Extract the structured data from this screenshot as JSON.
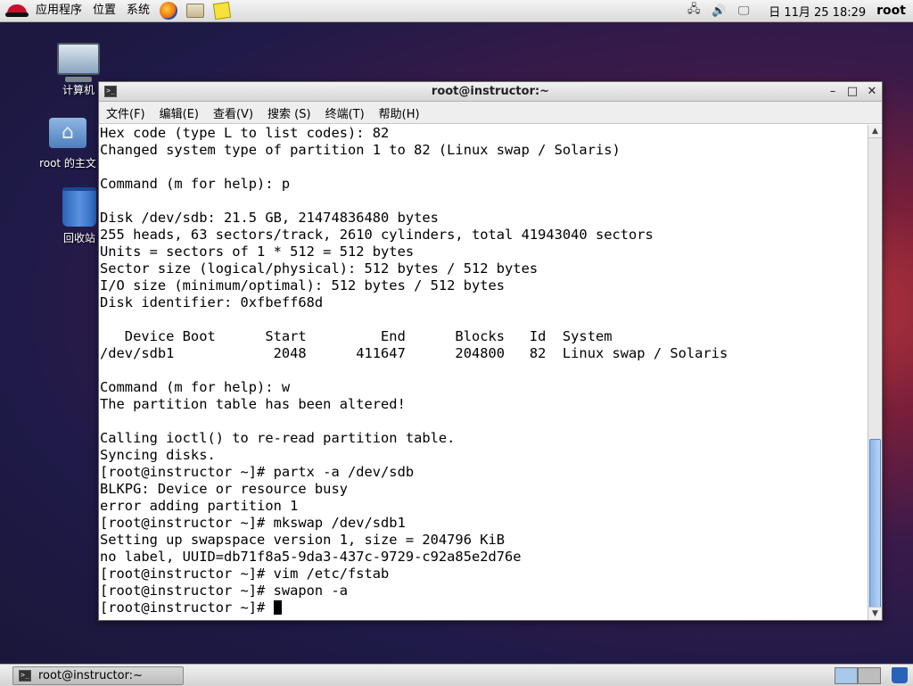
{
  "top_panel": {
    "menus": [
      "应用程序",
      "位置",
      "系统"
    ],
    "clock": "日 11月 25 18:29",
    "user": "root"
  },
  "desktop": {
    "icons": [
      "计算机",
      "root 的主文",
      "回收站"
    ]
  },
  "window": {
    "title": "root@instructor:~",
    "menus": [
      "文件(F)",
      "编辑(E)",
      "查看(V)",
      "搜索 (S)",
      "终端(T)",
      "帮助(H)"
    ],
    "lines": [
      "Hex code (type L to list codes): 82",
      "Changed system type of partition 1 to 82 (Linux swap / Solaris)",
      "",
      "Command (m for help): p",
      "",
      "Disk /dev/sdb: 21.5 GB, 21474836480 bytes",
      "255 heads, 63 sectors/track, 2610 cylinders, total 41943040 sectors",
      "Units = sectors of 1 * 512 = 512 bytes",
      "Sector size (logical/physical): 512 bytes / 512 bytes",
      "I/O size (minimum/optimal): 512 bytes / 512 bytes",
      "Disk identifier: 0xfbeff68d",
      "",
      "   Device Boot      Start         End      Blocks   Id  System",
      "/dev/sdb1            2048      411647      204800   82  Linux swap / Solaris",
      "",
      "Command (m for help): w",
      "The partition table has been altered!",
      "",
      "Calling ioctl() to re-read partition table.",
      "Syncing disks.",
      "[root@instructor ~]# partx -a /dev/sdb",
      "BLKPG: Device or resource busy",
      "error adding partition 1",
      "[root@instructor ~]# mkswap /dev/sdb1",
      "Setting up swapspace version 1, size = 204796 KiB",
      "no label, UUID=db71f8a5-9da3-437c-9729-c92a85e2d76e",
      "[root@instructor ~]# vim /etc/fstab",
      "[root@instructor ~]# swapon -a"
    ],
    "prompt": "[root@instructor ~]# "
  },
  "taskbar": {
    "task_label": "root@instructor:~"
  }
}
